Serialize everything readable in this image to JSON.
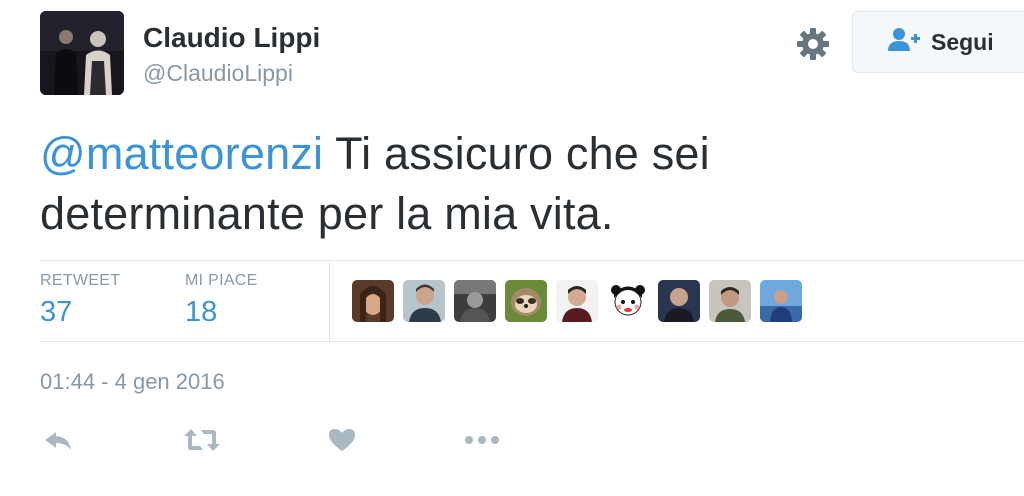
{
  "author": {
    "name": "Claudio Lippi",
    "handle": "@ClaudioLippi"
  },
  "follow_button": {
    "label": "Segui",
    "icon": "follow-person-plus-icon"
  },
  "settings_icon": "gear-icon",
  "tweet": {
    "mention": "@matteorenzi",
    "text_line1": " Ti assicuro che sei",
    "text_line2": "determinante per la mia vita."
  },
  "stats": {
    "retweet_label": "RETWEET",
    "retweet_count": "37",
    "likes_label": "MI PIACE",
    "likes_count": "18"
  },
  "likers_count_shown": 9,
  "timestamp": "01:44 - 4 gen 2016",
  "actions": [
    "reply-icon",
    "retweet-icon",
    "like-heart-icon",
    "more-dots-icon"
  ],
  "colors": {
    "accent": "#3b94d9",
    "muted": "#8899a6",
    "text": "#292f33",
    "border": "#e1e8ed"
  }
}
